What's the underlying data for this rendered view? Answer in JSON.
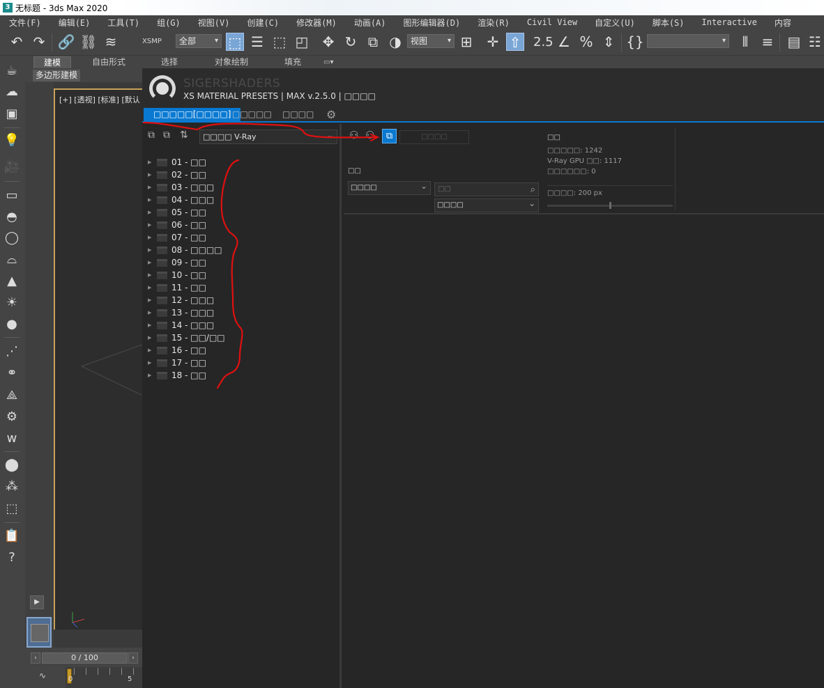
{
  "window": {
    "title": "无标题 - 3ds Max 2020",
    "app_icon": "3"
  },
  "menu": [
    "文件(F)",
    "编辑(E)",
    "工具(T)",
    "组(G)",
    "视图(V)",
    "创建(C)",
    "修改器(M)",
    "动画(A)",
    "图形编辑器(D)",
    "渲染(R)",
    "Civil View",
    "自定义(U)",
    "脚本(S)",
    "Interactive",
    "内容"
  ],
  "toolbar": {
    "xsmp_label": "XSMP",
    "selection_filter": "全部",
    "ref_coord": "视图",
    "snap_label": "2.5",
    "named_selection": ""
  },
  "ribbon": {
    "tabs": [
      "建模",
      "自由形式",
      "选择",
      "对象绘制",
      "填充"
    ],
    "sub_tab": "多边形建模"
  },
  "viewport": {
    "label": "[+] [透视] [标准] [默认"
  },
  "timeline": {
    "frame_readout": "0 / 100",
    "track_start": "0",
    "track_mark": "5"
  },
  "plugin": {
    "brand": "SIGERSHADERS",
    "subtitle": "XS MATERIAL PRESETS | MAX v.2.5.0 | □□□□",
    "tabs": [
      "□□□□□[□□□□]",
      "□□□□□",
      "□□□□"
    ],
    "renderer_select": "□□□□ V-Ray",
    "tree": [
      "01 - □□",
      "02 - □□",
      "03 - □□□",
      "04 - □□□",
      "05 - □□",
      "06 - □□",
      "07 - □□",
      "08 - □□□□",
      "09 - □□",
      "10 - □□",
      "11 - □□",
      "12 - □□□",
      "13 - □□□",
      "14 - □□□",
      "15 - □□/□□",
      "16 - □□",
      "17 - □□",
      "18 - □□"
    ],
    "filter_box": "□□□□",
    "sort_label": "□□",
    "sort_select_a": "□□□□",
    "search_placeholder": "□□",
    "sort_select_b": "□□□□",
    "info": {
      "title": "□□",
      "total": "□□□□□: 1242",
      "gpu": "V-Ray GPU □□: 1117",
      "selected": "□□□□□□: 0",
      "thumb_size": "□□□□: 200 px"
    },
    "thumb_size_fraction": 0.5
  },
  "colors": {
    "accent": "#0a79d1",
    "annotation": "#e01010",
    "viewport_border": "#c8a25a"
  }
}
